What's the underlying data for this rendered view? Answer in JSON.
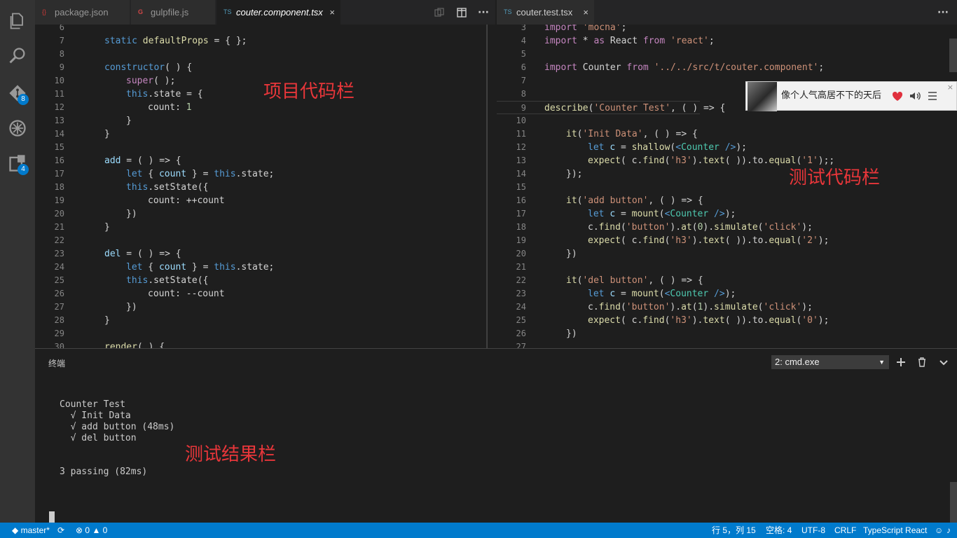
{
  "activity": {
    "scm_badge": "8",
    "extensions_badge": "4"
  },
  "tabs_left": [
    {
      "label": "package.json"
    },
    {
      "label": "gulpfile.js"
    },
    {
      "label": "couter.component.tsx"
    }
  ],
  "tabs_right": [
    {
      "label": "couter.test.tsx"
    }
  ],
  "icons": {
    "close": "×",
    "more": "···",
    "file_json": "{}",
    "file_gulp": "G",
    "file_tsx": "TS"
  },
  "editor_left": {
    "lines": [
      {
        "n": "6"
      },
      {
        "n": "7"
      },
      {
        "n": "8"
      },
      {
        "n": "9"
      },
      {
        "n": "10"
      },
      {
        "n": "11"
      },
      {
        "n": "12"
      },
      {
        "n": "13"
      },
      {
        "n": "14"
      },
      {
        "n": "15"
      },
      {
        "n": "16"
      },
      {
        "n": "17"
      },
      {
        "n": "18"
      },
      {
        "n": "19"
      },
      {
        "n": "20"
      },
      {
        "n": "21"
      },
      {
        "n": "22"
      },
      {
        "n": "23"
      },
      {
        "n": "24"
      },
      {
        "n": "25"
      },
      {
        "n": "26"
      },
      {
        "n": "27"
      },
      {
        "n": "28"
      },
      {
        "n": "29"
      },
      {
        "n": "30"
      }
    ],
    "annotation": "项目代码栏"
  },
  "editor_right": {
    "lines": [
      {
        "n": "3"
      },
      {
        "n": "4"
      },
      {
        "n": "5"
      },
      {
        "n": "6"
      },
      {
        "n": "7"
      },
      {
        "n": "8"
      },
      {
        "n": "9"
      },
      {
        "n": "10"
      },
      {
        "n": "11"
      },
      {
        "n": "12"
      },
      {
        "n": "13"
      },
      {
        "n": "14"
      },
      {
        "n": "15"
      },
      {
        "n": "16"
      },
      {
        "n": "17"
      },
      {
        "n": "18"
      },
      {
        "n": "19"
      },
      {
        "n": "20"
      },
      {
        "n": "21"
      },
      {
        "n": "22"
      },
      {
        "n": "23"
      },
      {
        "n": "24"
      },
      {
        "n": "25"
      },
      {
        "n": "26"
      },
      {
        "n": "27"
      }
    ],
    "annotation": "测试代码栏"
  },
  "music": {
    "title": "像个人气高居不下的天后"
  },
  "panel": {
    "title": "终端",
    "terminal_selected": "2: cmd.exe",
    "output": [
      "Counter Test",
      "  √ Init Data",
      "  √ add button (48ms)",
      "  √ del button",
      "",
      "",
      "3 passing (82ms)"
    ],
    "annotation": "测试结果栏"
  },
  "status": {
    "branch": "master*",
    "errors": "0",
    "warnings": "0",
    "position": "行 5，列 15",
    "spaces": "空格: 4",
    "encoding": "UTF-8",
    "eol": "CRLF",
    "language": "TypeScript React"
  },
  "colors": {
    "accent": "#007acc",
    "activity_bar": "#333333",
    "editor_bg": "#1e1e1e",
    "annotation_red": "#e8363a"
  }
}
